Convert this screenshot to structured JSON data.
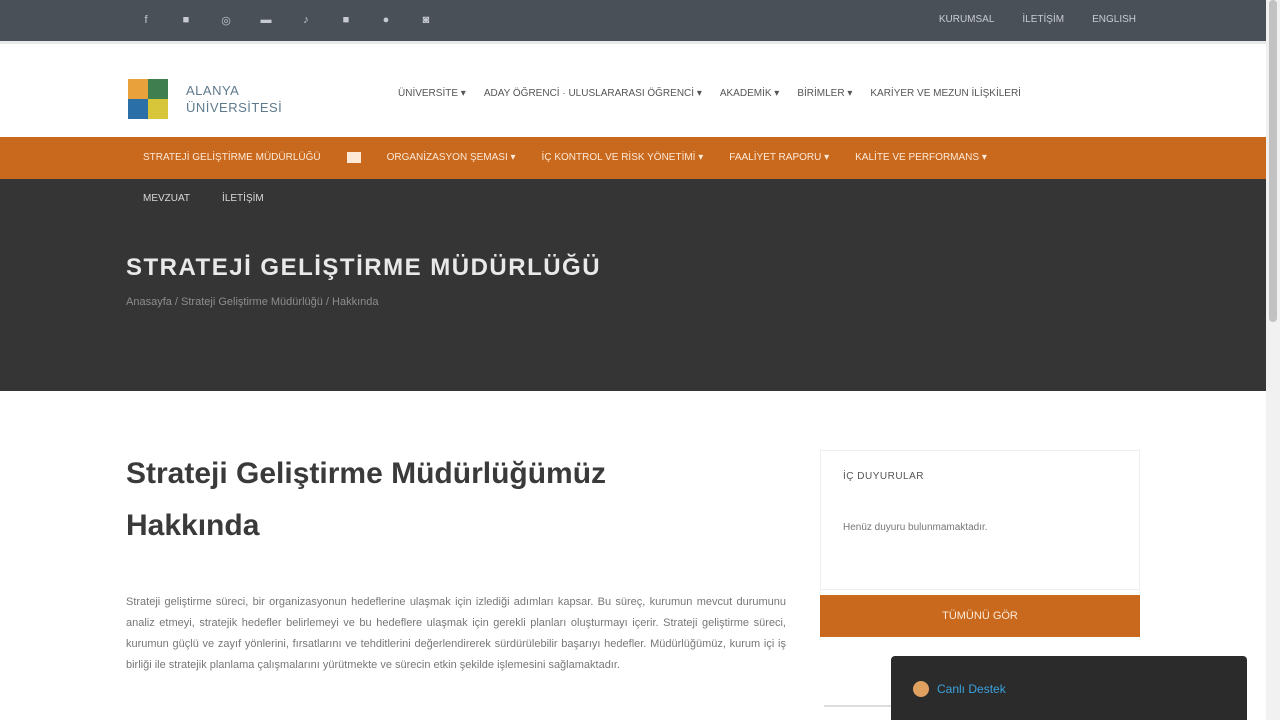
{
  "topbar": {
    "social_icons": [
      "facebook-icon",
      "twitter-icon",
      "instagram-icon",
      "youtube-icon",
      "tiktok-icon",
      "linkedin-icon",
      "pinterest-icon",
      "rss-icon"
    ],
    "links": [
      "KURUMSAL",
      "İLETİŞİM",
      "ENGLISH"
    ]
  },
  "header": {
    "logo_line1": "ALANYA",
    "logo_line2": "ÜNİVERSİTESİ",
    "logo_colors": [
      "#e9a23b",
      "#3f7e4f",
      "#2a6fa8",
      "#d7c63a"
    ],
    "nav": [
      "ÜNİVERSİTE ▾",
      "ADAY ÖĞRENCİ · ULUSLARARASI ÖĞRENCİ ▾",
      "AKADEMİK ▾",
      "BİRİMLER ▾",
      "KARİYER VE MEZUN İLİŞKİLERİ"
    ]
  },
  "orange_nav": {
    "first": "STRATEJİ GELİŞTİRME MÜDÜRLÜĞÜ",
    "home_icon": "home-icon",
    "items": [
      "ORGANİZASYON ŞEMASI ▾",
      "İÇ KONTROL VE RİSK YÖNETİMİ ▾",
      "FAALİYET RAPORU ▾",
      "KALİTE VE PERFORMANS ▾"
    ]
  },
  "hero": {
    "subnav": [
      "MEVZUAT",
      "İLETİŞİM"
    ],
    "title": "STRATEJİ GELİŞTİRME MÜDÜRLÜĞÜ",
    "breadcrumb": "Anasayfa / Strateji Geliştirme Müdürlüğü / Hakkında"
  },
  "content": {
    "heading_line1": "Strateji Geliştirme Müdürlüğümüz",
    "heading_line2": "Hakkında",
    "paragraph": "Strateji geliştirme süreci, bir organizasyonun hedeflerine ulaşmak için izlediği adımları kapsar. Bu süreç, kurumun mevcut durumunu analiz etmeyi, stratejik hedefler belirlemeyi ve bu hedeflere ulaşmak için gerekli planları oluşturmayı içerir. Strateji geliştirme süreci, kurumun güçlü ve zayıf yönlerini, fırsatlarını ve tehditlerini değerlendirerek sürdürülebilir başarıyı hedefler. Müdürlüğümüz, kurum içi iş birliği ile stratejik planlama çalışmalarını yürütmekte ve sürecin etkin şekilde işlemesini sağlamaktadır."
  },
  "sidebar": {
    "title": "İÇ DUYURULAR",
    "text": "Henüz duyuru bulunmamaktadır.",
    "button": "TÜMÜNÜ GÖR"
  },
  "chat": {
    "label": "Canlı Destek"
  }
}
